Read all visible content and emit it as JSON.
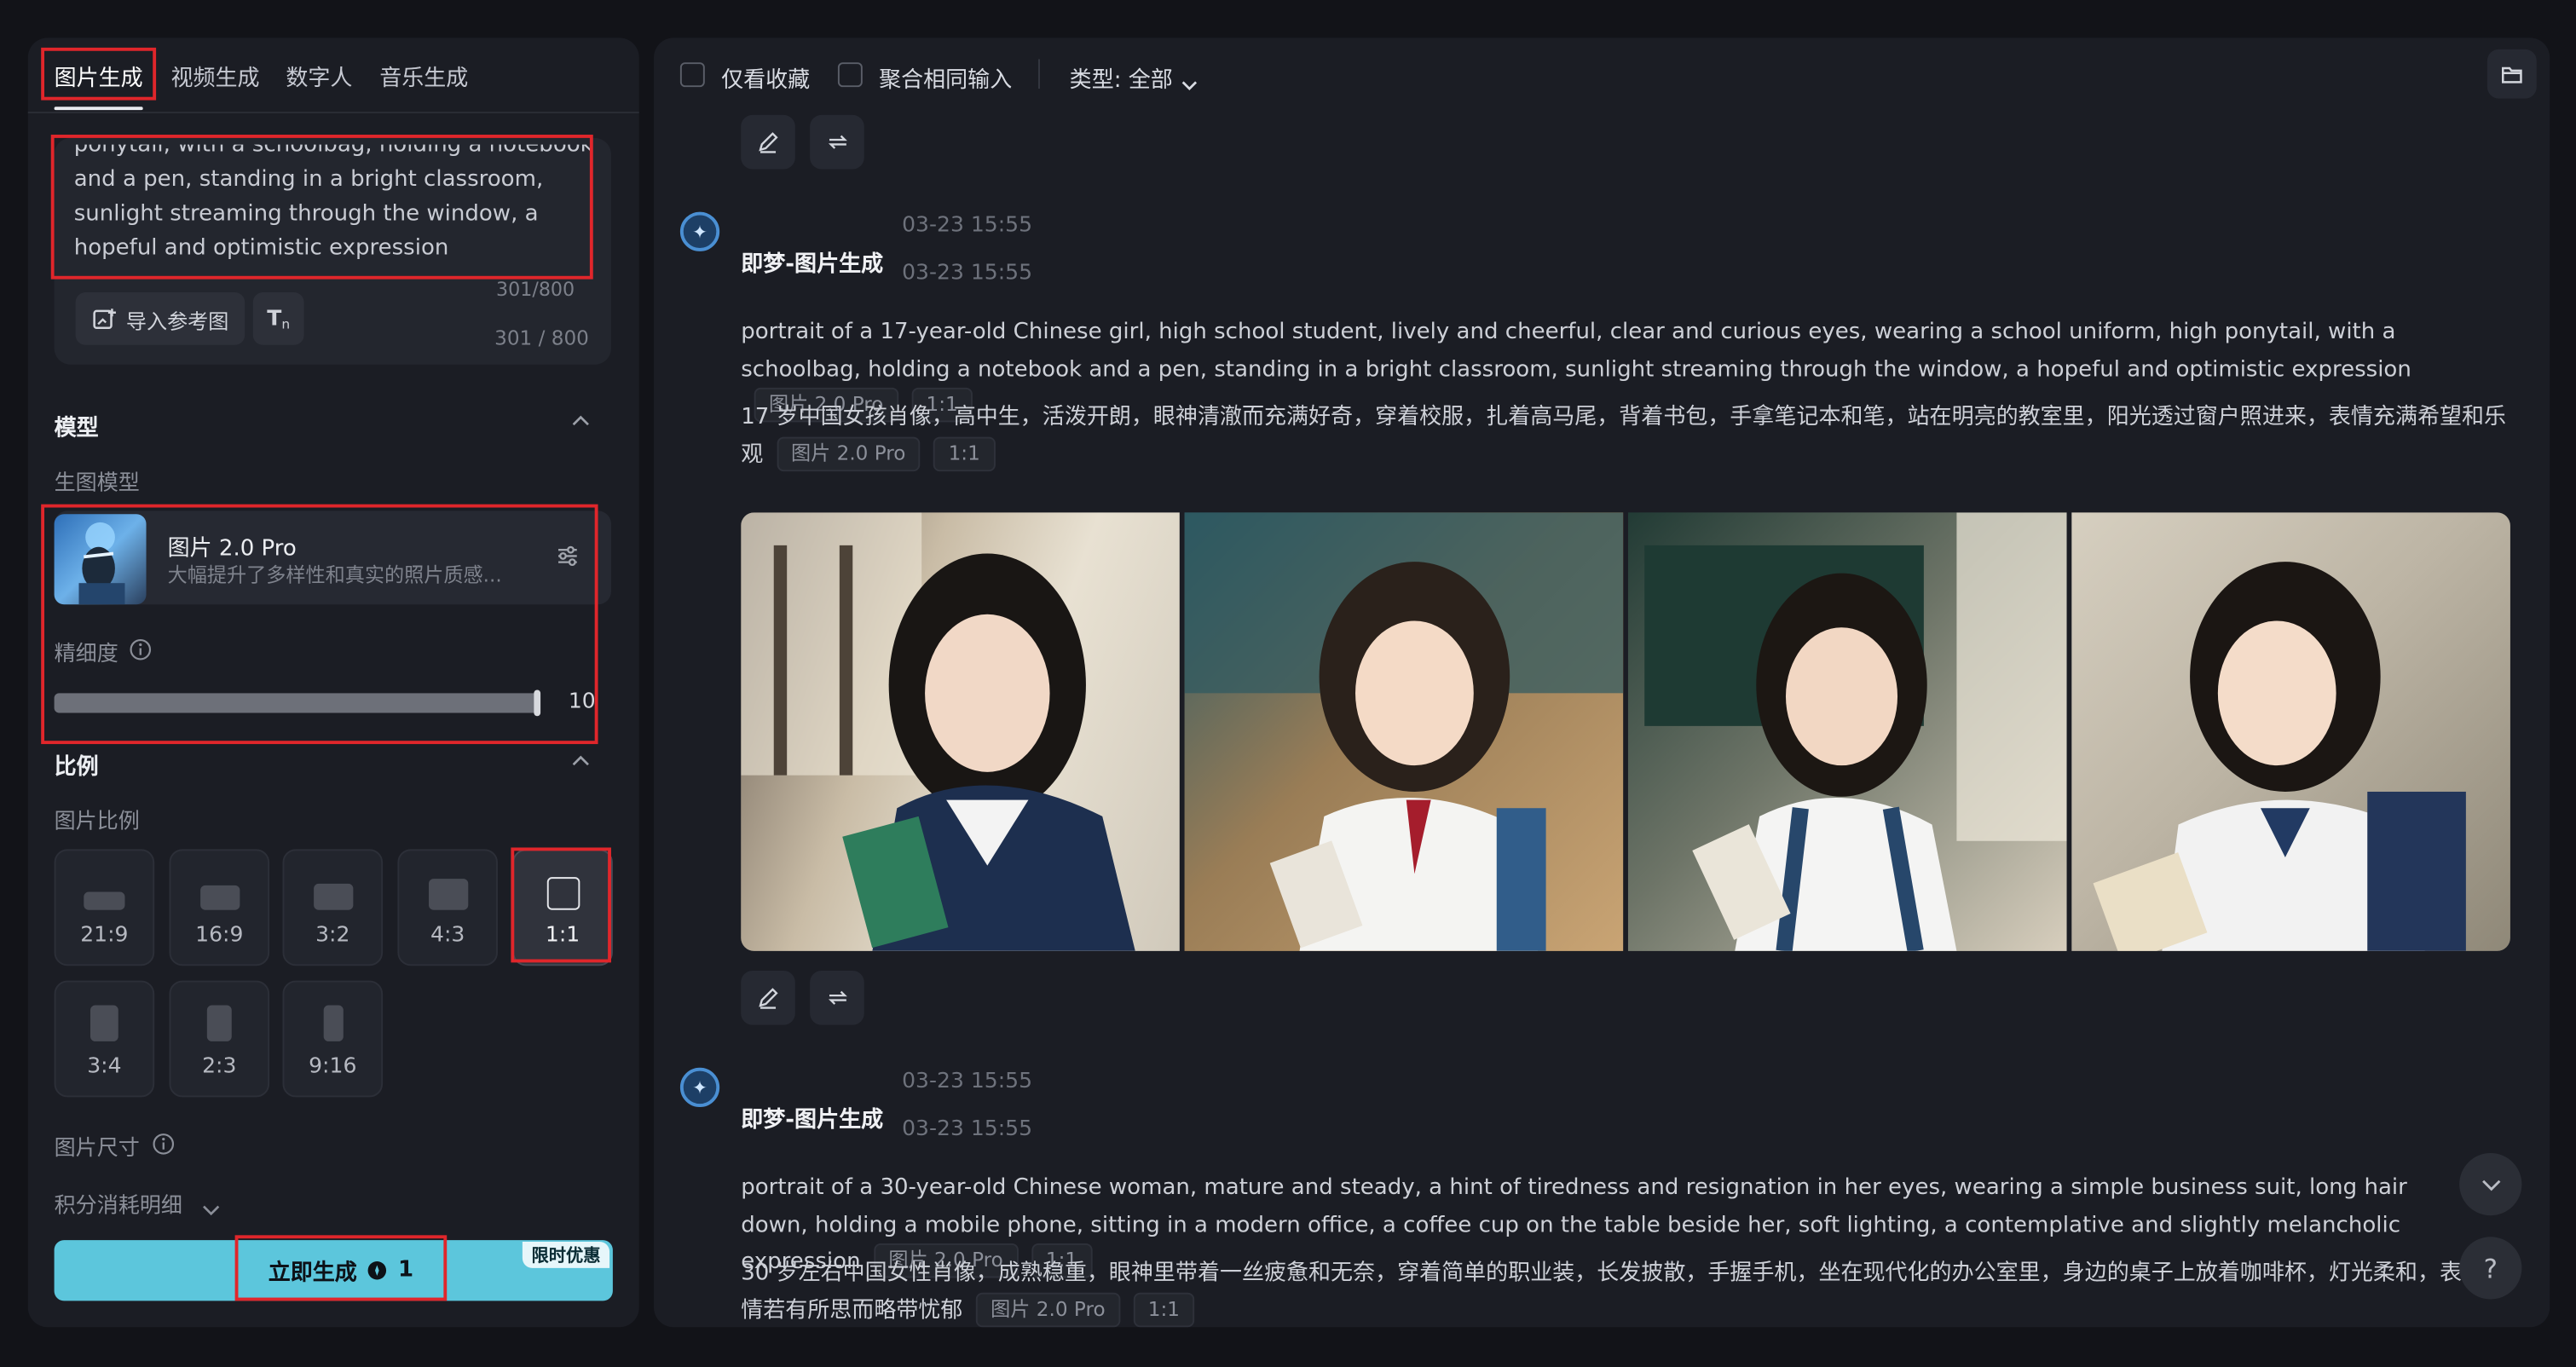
{
  "tabs": [
    {
      "label": "图片生成",
      "active": true
    },
    {
      "label": "视频生成",
      "active": false
    },
    {
      "label": "数字人",
      "active": false
    },
    {
      "label": "音乐生成",
      "active": false
    }
  ],
  "prompt": {
    "text_lines": [
      "ponytail, with a schoolbag, holding a notebook",
      "and a pen, standing in a bright classroom,",
      "sunlight streaming through the window, a",
      "hopeful and optimistic expression"
    ],
    "counter_inner": "301/800",
    "counter_outer": "301 / 800",
    "import_ref_label": "导入参考图",
    "text_tool_label": "T"
  },
  "model_section": {
    "title": "模型",
    "sub_label": "生图模型",
    "model_name": "图片 2.0 Pro",
    "model_desc": "大幅提升了多样性和真实的照片质感...",
    "precision_label": "精细度",
    "precision_value": "10",
    "precision_fraction": 0.98
  },
  "ratio_section": {
    "title": "比例",
    "sub_label": "图片比例",
    "options": [
      {
        "label": "21:9",
        "selected": false
      },
      {
        "label": "16:9",
        "selected": false
      },
      {
        "label": "3:2",
        "selected": false
      },
      {
        "label": "4:3",
        "selected": false
      },
      {
        "label": "1:1",
        "selected": true
      },
      {
        "label": "3:4",
        "selected": false
      },
      {
        "label": "2:3",
        "selected": false
      },
      {
        "label": "9:16",
        "selected": false
      }
    ],
    "size_label": "图片尺寸",
    "cost_label": "积分消耗明细"
  },
  "generate": {
    "label": "立即生成",
    "cost": "1",
    "promo": "限时优惠"
  },
  "toolbar": {
    "favorites_label": "仅看收藏",
    "group_label": "聚合相同输入",
    "type_label": "类型: 全部"
  },
  "messages": [
    {
      "sender": "即梦-图片生成",
      "time1": "03-23  15:55",
      "time2": "03-23  15:55",
      "en": "portrait of a 17-year-old Chinese girl, high school student, lively and cheerful, clear and curious eyes, wearing a school uniform, high ponytail, with a schoolbag, holding a notebook and a pen, standing in a bright classroom, sunlight streaming through the window, a hopeful and optimistic expression",
      "zh": "17 岁中国女孩肖像，高中生，活泼开朗，眼神清澈而充满好奇，穿着校服，扎着高马尾，背着书包，手拿笔记本和笔，站在明亮的教室里，阳光透过窗户照进来，表情充满希望和乐观",
      "tag_model": "图片 2.0 Pro",
      "tag_ratio": "1:1"
    },
    {
      "sender": "即梦-图片生成",
      "time1": "03-23  15:55",
      "time2": "03-23  15:55",
      "en": "portrait of a 30-year-old Chinese woman, mature and steady, a hint of tiredness and resignation in her eyes, wearing a simple business suit, long hair down, holding a mobile phone, sitting in a modern office, a coffee cup on the table beside her, soft lighting, a contemplative and slightly melancholic expression",
      "zh": "30 岁左右中国女性肖像，成熟稳重，眼神里带着一丝疲惫和无奈，穿着简单的职业装，长发披散，手握手机，坐在现代化的办公室里，身边的桌子上放着咖啡杯，灯光柔和，表情若有所思而略带忧郁",
      "tag_model": "图片 2.0 Pro",
      "tag_ratio": "1:1"
    }
  ],
  "float": {
    "help": "?"
  }
}
